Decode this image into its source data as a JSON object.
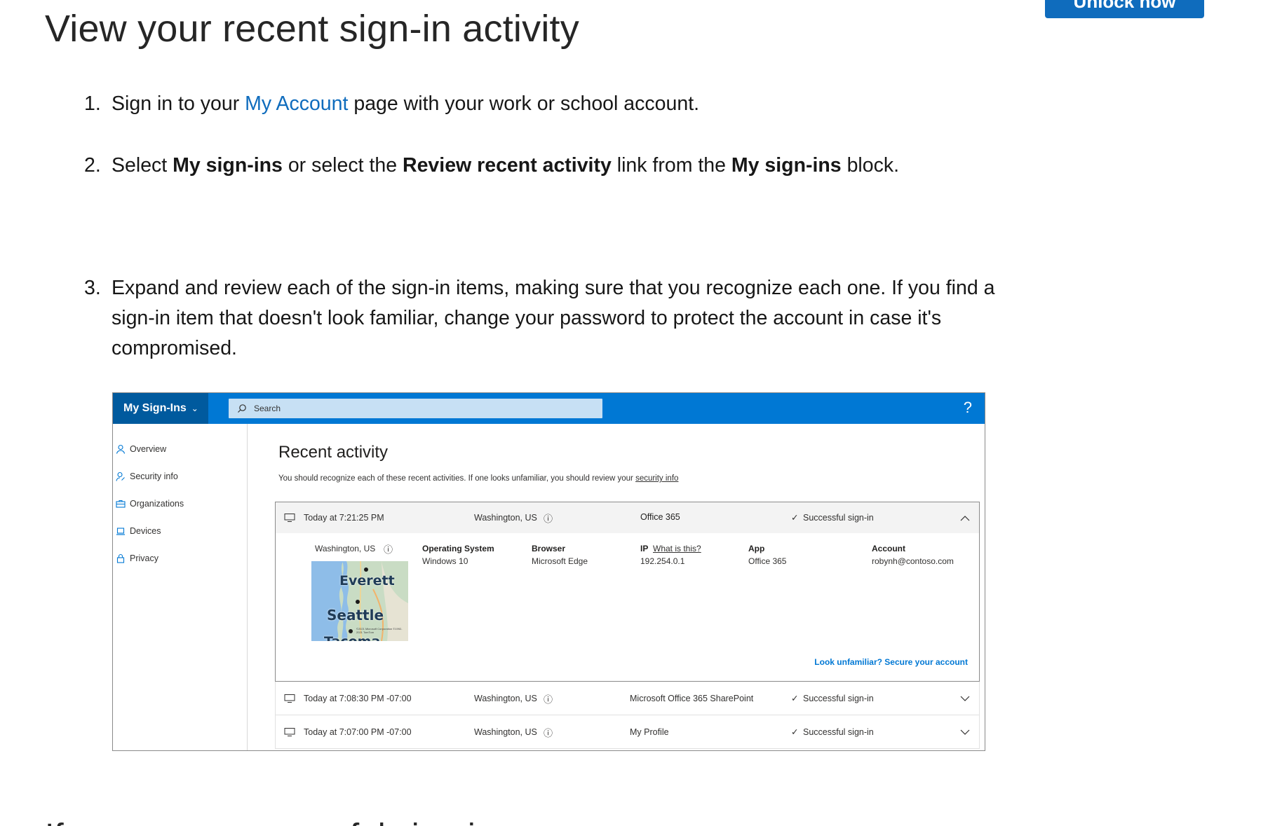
{
  "header": {
    "unlock_button": "Unlock now",
    "title": "View your recent sign-in activity"
  },
  "steps": [
    {
      "num": "1.",
      "pre": "Sign in to your ",
      "link": "My Account",
      "post": " page with your work or school account."
    },
    {
      "num": "2.",
      "t1": "Select ",
      "b1": "My sign-ins",
      "t2": " or select the ",
      "b2": "Review recent activity",
      "t3": " link from the ",
      "b3": "My sign-ins",
      "t4": " block."
    },
    {
      "num": "3.",
      "text": "Expand and review each of the sign-in items, making sure that you recognize each one. If you find a sign-in item that doesn't look familiar, change your password to protect the account in case it's compromised."
    }
  ],
  "screenshot": {
    "app_title": "My Sign-Ins",
    "search_placeholder": "Search",
    "help": "?",
    "nav": [
      "Overview",
      "Security info",
      "Organizations",
      "Devices",
      "Privacy"
    ],
    "heading": "Recent activity",
    "subtitle": "You should recognize each of these recent activities. If one looks unfamiliar, you should review your ",
    "subtitle_link": "security info",
    "expanded": {
      "time": "Today at 7:21:25 PM",
      "location": "Washington, US",
      "app": "Office 365",
      "status": "Successful sign-in",
      "detail_location": "Washington, US",
      "os_label": "Operating System",
      "os_value": "Windows 10",
      "browser_label": "Browser",
      "browser_value": "Microsoft Edge",
      "ip_label": "IP",
      "ip_link": "What is this?",
      "ip_value": "192.254.0.1",
      "app_label": "App",
      "app_value": "Office 365",
      "account_label": "Account",
      "account_value": "robynh@contoso.com",
      "map_city1": "Everett",
      "map_city2": "Seattle",
      "map_city3": "Tacoma",
      "map_copyright": "©2021 Microsoft Corporation ©1992-2021 TomTom",
      "secure_link": "Look unfamiliar? Secure your account"
    },
    "rows": [
      {
        "time": "Today at 7:08:30 PM -07:00",
        "location": "Washington, US",
        "app": "Microsoft Office 365 SharePoint",
        "status": "Successful sign-in"
      },
      {
        "time": "Today at 7:07:00 PM -07:00",
        "location": "Washington, US",
        "app": "My Profile",
        "status": "Successful sign-in"
      }
    ]
  },
  "next_heading": "If you see a successful sign-in"
}
